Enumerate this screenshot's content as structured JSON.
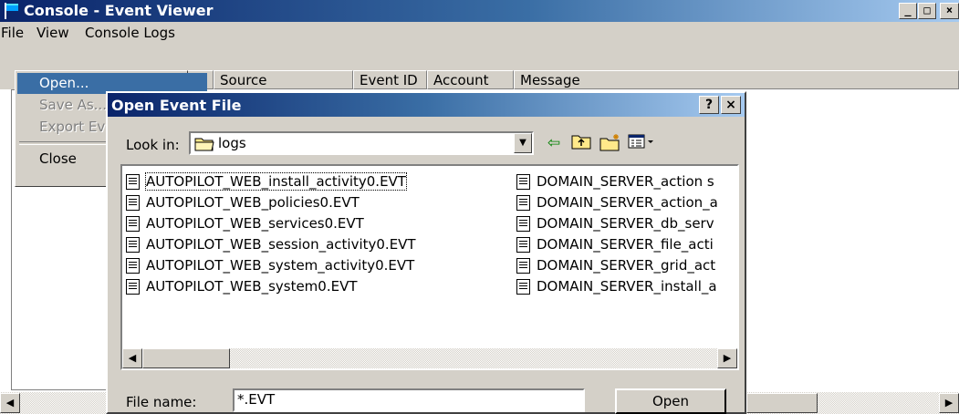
{
  "window": {
    "title": "Console - Event Viewer",
    "minimize": "_",
    "maximize": "□",
    "close": "×"
  },
  "menubar": [
    "File",
    "View",
    "Console Logs"
  ],
  "list_columns": [
    "Source",
    "Event ID",
    "Account",
    "Message"
  ],
  "file_menu": {
    "items": [
      {
        "label": "Open...",
        "state": "selected"
      },
      {
        "label": "Save As...",
        "state": "disabled"
      },
      {
        "label": "Export Ev",
        "state": "disabled"
      },
      {
        "label": "Close",
        "state": "enabled"
      }
    ]
  },
  "dialog": {
    "title": "Open Event File",
    "help": "?",
    "close": "×",
    "look_in_label": "Look in:",
    "look_in_value": "logs",
    "toolbar_icons": [
      "back-icon",
      "up-folder-icon",
      "new-folder-icon",
      "view-menu-icon"
    ],
    "files_col1": [
      "AUTOPILOT_WEB_install_activity0.EVT",
      "AUTOPILOT_WEB_policies0.EVT",
      "AUTOPILOT_WEB_services0.EVT",
      "AUTOPILOT_WEB_session_activity0.EVT",
      "AUTOPILOT_WEB_system_activity0.EVT",
      "AUTOPILOT_WEB_system0.EVT"
    ],
    "files_col2": [
      "DOMAIN_SERVER_action s",
      "DOMAIN_SERVER_action_a",
      "DOMAIN_SERVER_db_serv",
      "DOMAIN_SERVER_file_acti",
      "DOMAIN_SERVER_grid_act",
      "DOMAIN_SERVER_install_a"
    ],
    "file_name_label": "File name:",
    "file_name_value": "*.EVT",
    "open_button": "Open"
  },
  "colors": {
    "title_active": "#0a246a",
    "highlight": "#3a6ea5",
    "face": "#d4d0c8"
  }
}
